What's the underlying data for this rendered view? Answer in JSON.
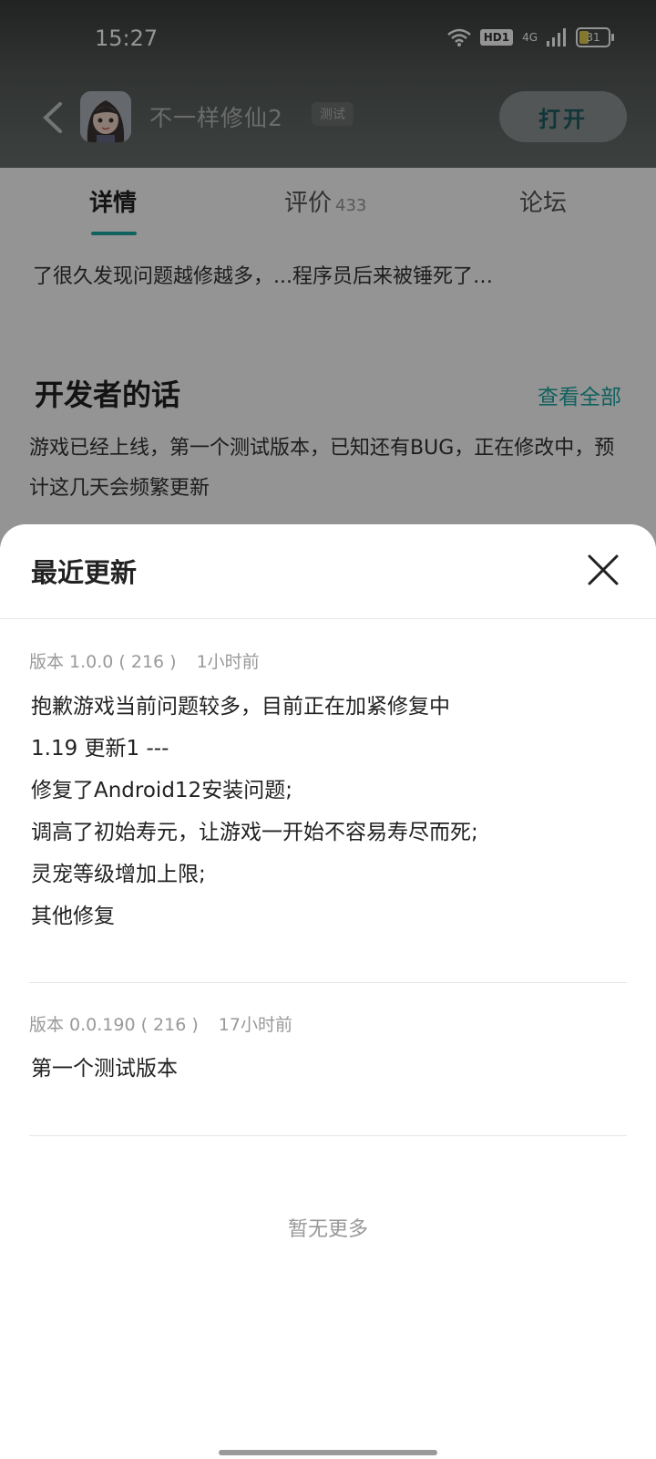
{
  "status_bar": {
    "time": "15:27",
    "hd_label": "HD1",
    "network": "4G",
    "battery": "31"
  },
  "header": {
    "app_name": "不一样修仙2",
    "test_tag": "测试",
    "open_button": "打开"
  },
  "tabs": [
    {
      "label": "详情",
      "count": ""
    },
    {
      "label": "评价",
      "count": "433"
    },
    {
      "label": "论坛",
      "count": ""
    }
  ],
  "description_tail": "了很久发现问题越修越多，...程序员后来被锤死了…",
  "developer_note": {
    "title": "开发者的话",
    "view_all": "查看全部",
    "text": "游戏已经上线，第一个测试版本，已知还有BUG，正在修改中，预计这几天会频繁更新"
  },
  "sheet": {
    "title": "最近更新",
    "entries": [
      {
        "version": "版本 1.0.0 ( 216 )",
        "time": "1小时前",
        "notes": [
          "抱歉游戏当前问题较多，目前正在加紧修复中",
          "1.19 更新1 ---",
          "修复了Android12安装问题;",
          "调高了初始寿元，让游戏一开始不容易寿尽而死;",
          "灵宠等级增加上限;",
          "其他修复"
        ]
      },
      {
        "version": "版本 0.0.190 ( 216 )",
        "time": "17小时前",
        "notes": [
          "第一个测试版本"
        ]
      }
    ],
    "no_more": "暂无更多"
  }
}
